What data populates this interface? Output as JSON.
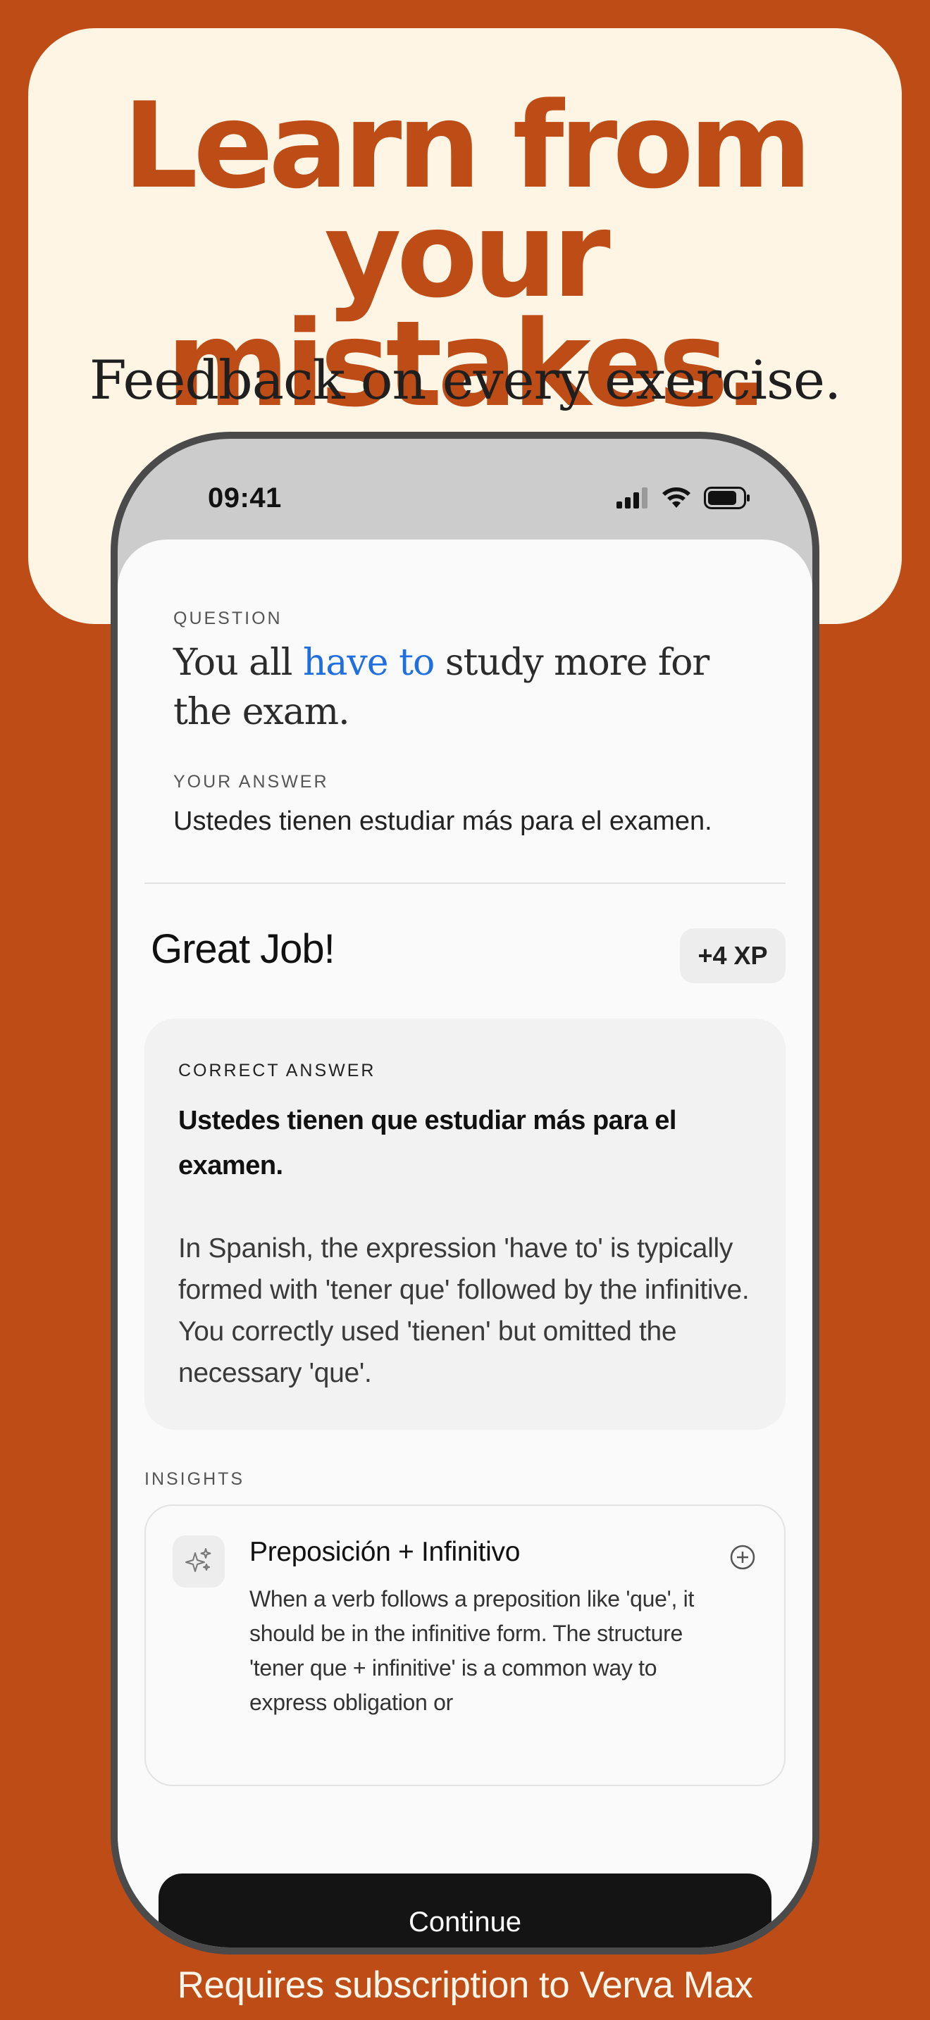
{
  "promo": {
    "headline_line1": "Learn from",
    "headline_line2": "your mistakes.",
    "subhead": "Feedback on every exercise.",
    "footnote": "Requires subscription to Verva Max"
  },
  "status_bar": {
    "time": "09:41",
    "icons": [
      "cellular-signal-icon",
      "wifi-icon",
      "battery-icon"
    ]
  },
  "exercise": {
    "question_label": "QUESTION",
    "question_before": "You all ",
    "question_highlight": "have to",
    "question_after": " study more for the exam.",
    "answer_label": "YOUR ANSWER",
    "answer_text": "Ustedes tienen estudiar más para el examen."
  },
  "result": {
    "title": "Great Job!",
    "xp": "+4 XP",
    "correct_label": "CORRECT ANSWER",
    "correct_answer": "Ustedes tienen que estudiar más para el examen.",
    "explanation": "In Spanish, the expression 'have to' is typically formed with 'tener que' followed by the infinitive. You correctly used 'tienen' but omitted the necessary 'que'."
  },
  "insights": {
    "label": "INSIGHTS",
    "items": [
      {
        "icon": "sparkles-icon",
        "title": "Preposición + Infinitivo",
        "body": "When a verb follows a preposition like 'que', it should be in the infinitive form. The structure 'tener que + infinitive' is a common way to express obligation or"
      }
    ]
  },
  "actions": {
    "continue_label": "Continue"
  },
  "colors": {
    "background": "#BD4C17",
    "card": "#FEF5E4",
    "highlight": "#1F6FE0",
    "button": "#141414"
  }
}
